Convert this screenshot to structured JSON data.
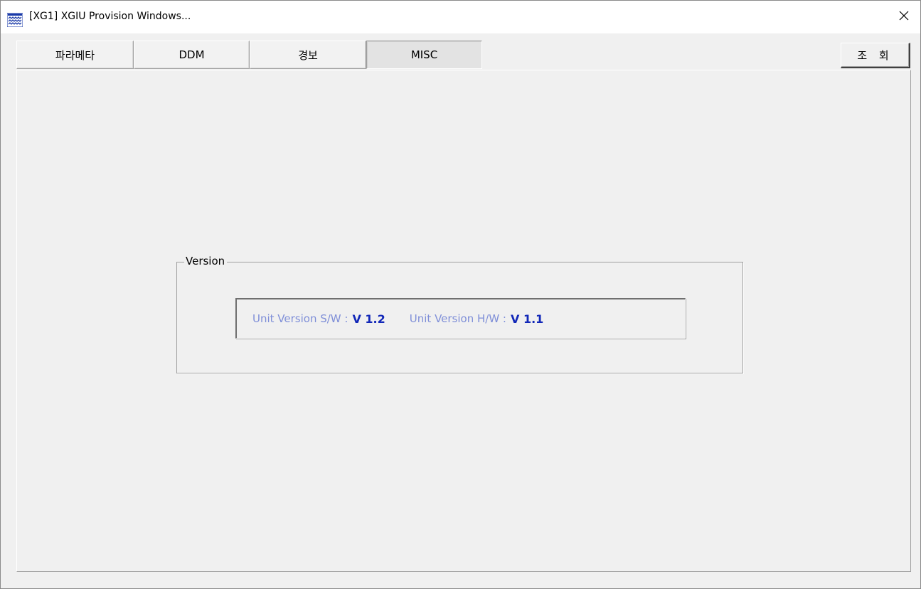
{
  "window": {
    "title": "[XG1] XGIU Provision Windows...",
    "icon": "app-icon",
    "close_icon": "close-icon"
  },
  "tabs": [
    {
      "label": "파라메타",
      "active": false
    },
    {
      "label": "DDM",
      "active": false
    },
    {
      "label": "경보",
      "active": false
    },
    {
      "label": "MISC",
      "active": true
    }
  ],
  "toolbar": {
    "query_label": "조 회"
  },
  "version_group": {
    "title": "Version",
    "sw_label": "Unit Version S/W :",
    "sw_value": "V 1.2",
    "hw_label": "Unit Version H/W :",
    "hw_value": "V 1.1"
  },
  "colors": {
    "label_color": "#7f8fd8",
    "value_color": "#1228b8",
    "background": "#f0f0f0"
  }
}
